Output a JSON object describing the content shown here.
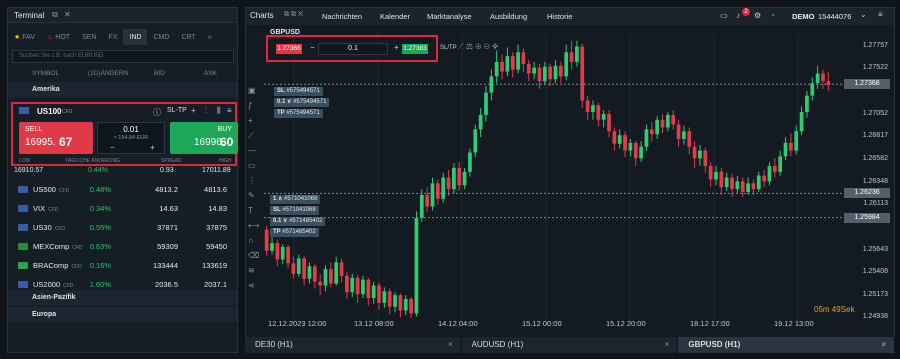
{
  "terminal": {
    "title": "Terminal",
    "tabs": [
      {
        "icon": "star-icon",
        "label": "FAV"
      },
      {
        "icon": "flame-icon",
        "label": "HOT"
      },
      {
        "label": "SEN"
      },
      {
        "label": "FX"
      },
      {
        "label": "IND"
      },
      {
        "label": "CMD"
      },
      {
        "label": "CRT"
      }
    ],
    "more": "»",
    "search_placeholder": "Suchen Sie z.B. nach EURUSD",
    "columns": {
      "symbol": "SYMBOL",
      "change": "(1D)ÄNDERN",
      "bid": "BID",
      "ask": "ASK"
    },
    "groups": {
      "amerika": "Amerika",
      "asien": "Asien-Pazifik",
      "europa": "Europa"
    },
    "selected": {
      "name": "US100",
      "tag": "CFD",
      "info": "ⓘ",
      "sltp": "SL-TP",
      "plus": "+",
      "sell_label": "SELL",
      "sell_big": "16995.",
      "sell_small": "67",
      "buy_label": "BUY",
      "buy_big": "16996.",
      "buy_small": "60",
      "volume": "0.01",
      "margin": "≈ 154.84 EUR",
      "minus": "−",
      "plus2": "+",
      "low": "LOW",
      "daily": "TÄGLICHE ÄNDERUNG",
      "spread": "SPREAD",
      "high": "HIGH",
      "low_v": "16910.57",
      "daily_v": "0.44%",
      "spread_v": "0.93",
      "high_v": "17011.89"
    },
    "rows": [
      {
        "name": "US500",
        "tag": "CFD",
        "chg": "0.48%",
        "bid": "4813.2",
        "ask": "4813.6",
        "flag": "#3c5ba8"
      },
      {
        "name": "VIX",
        "tag": "CFD",
        "chg": "0.34%",
        "bid": "14.63",
        "ask": "14.83",
        "flag": "#3c5ba8"
      },
      {
        "name": "US30",
        "tag": "CFD",
        "chg": "0.55%",
        "bid": "37871",
        "ask": "37875",
        "flag": "#3c5ba8"
      },
      {
        "name": "MEXComp",
        "tag": "CFD",
        "chg": "0.63%",
        "bid": "59309",
        "ask": "59450",
        "flag": "#2a8a3e"
      },
      {
        "name": "BRAComp",
        "tag": "CFD",
        "chg": "0.16%",
        "bid": "133444",
        "ask": "133619",
        "flag": "#2ba34b"
      },
      {
        "name": "US2000",
        "tag": "CFD",
        "chg": "1.60%",
        "bid": "2036.5",
        "ask": "2037.1",
        "flag": "#3c5ba8"
      }
    ]
  },
  "charts": {
    "title": "Charts",
    "nav": [
      "Nachrichten",
      "Kalender",
      "Marktanalyse",
      "Ausbildung",
      "Historie"
    ],
    "demo_label": "DEMO",
    "account": "15444076",
    "badge": "2",
    "order": {
      "symbol": "GBPUSD",
      "sell_price": "1.27368",
      "volume": "0.1",
      "buy_price": "1.27383",
      "sltp": "SL/TP"
    },
    "y_labels": [
      "1.27757",
      "1.27522",
      "1.27368",
      "1.27052",
      "1.26817",
      "1.26582",
      "1.26348",
      "1.26236",
      "1.26113",
      "1.25984",
      "1.25643",
      "1.25408",
      "1.25173",
      "1.24938"
    ],
    "x_labels": [
      "12.12.2023 12:00",
      "13.12 08:00",
      "14.12 04:00",
      "15.12 00:00",
      "15.12 20:00",
      "18.12 17:00",
      "19.12 13:00"
    ],
    "timer": "05m 49Sek",
    "orders_top": [
      {
        "k": "SL",
        "v": "#575494571"
      },
      {
        "k": "0.1 ∨",
        "v": "#575494571"
      },
      {
        "k": "TP",
        "v": "#575494571"
      }
    ],
    "orders_bot": [
      {
        "k": "1 ∧",
        "v": "#571041068"
      },
      {
        "k": "SL",
        "v": "#571041068"
      },
      {
        "k": "0.1 ∨",
        "v": "#571485402"
      },
      {
        "k": "TP",
        "v": "#571485402"
      }
    ]
  },
  "bottom_tabs": [
    {
      "label": "DE30 (H1)",
      "close": "×"
    },
    {
      "label": "AUDUSD (H1)",
      "close": "×"
    },
    {
      "label": "GBPUSD (H1)",
      "close": "×"
    }
  ],
  "colors": {
    "up": "#2ecc71",
    "down": "#e23b4a",
    "bg": "#131a21"
  },
  "candles": [
    [
      1.2586,
      1.2564,
      1.259,
      1.2558
    ],
    [
      1.2564,
      1.2572,
      1.2578,
      1.256
    ],
    [
      1.2572,
      1.2555,
      1.2575,
      1.2548
    ],
    [
      1.2555,
      1.2568,
      1.2571,
      1.255
    ],
    [
      1.2568,
      1.2551,
      1.257,
      1.2546
    ],
    [
      1.2551,
      1.254,
      1.2558,
      1.2535
    ],
    [
      1.254,
      1.2556,
      1.256,
      1.2537
    ],
    [
      1.2556,
      1.2535,
      1.2559,
      1.2528
    ],
    [
      1.2535,
      1.2548,
      1.2552,
      1.253
    ],
    [
      1.2548,
      1.2532,
      1.255,
      1.2525
    ],
    [
      1.2532,
      1.2528,
      1.254,
      1.2518
    ],
    [
      1.2528,
      1.2545,
      1.2549,
      1.2522
    ],
    [
      1.2545,
      1.253,
      1.2552,
      1.2526
    ],
    [
      1.253,
      1.2552,
      1.2558,
      1.2528
    ],
    [
      1.2552,
      1.2538,
      1.2556,
      1.2531
    ],
    [
      1.2538,
      1.2521,
      1.2542,
      1.2514
    ],
    [
      1.2521,
      1.2536,
      1.254,
      1.2516
    ],
    [
      1.2536,
      1.2519,
      1.2539,
      1.251
    ],
    [
      1.2519,
      1.2534,
      1.2538,
      1.2515
    ],
    [
      1.2534,
      1.2515,
      1.2536,
      1.2507
    ],
    [
      1.2515,
      1.2528,
      1.2532,
      1.2509
    ],
    [
      1.2528,
      1.251,
      1.2531,
      1.2503
    ],
    [
      1.251,
      1.2522,
      1.2526,
      1.2505
    ],
    [
      1.2522,
      1.2506,
      1.2525,
      1.2498
    ],
    [
      1.2506,
      1.2518,
      1.2521,
      1.25
    ],
    [
      1.2518,
      1.2502,
      1.252,
      1.2495
    ],
    [
      1.2502,
      1.2514,
      1.2518,
      1.2497
    ],
    [
      1.2514,
      1.2499,
      1.2516,
      1.2494
    ],
    [
      1.2499,
      1.2598,
      1.2605,
      1.2496
    ],
    [
      1.2598,
      1.2622,
      1.2628,
      1.2594
    ],
    [
      1.2622,
      1.261,
      1.263,
      1.2604
    ],
    [
      1.261,
      1.2634,
      1.264,
      1.2606
    ],
    [
      1.2634,
      1.2618,
      1.2638,
      1.2612
    ],
    [
      1.2618,
      1.264,
      1.2645,
      1.2614
    ],
    [
      1.264,
      1.2628,
      1.2648,
      1.2621
    ],
    [
      1.2628,
      1.265,
      1.2655,
      1.2624
    ],
    [
      1.265,
      1.2632,
      1.2656,
      1.2626
    ],
    [
      1.2632,
      1.2646,
      1.265,
      1.2628
    ],
    [
      1.2646,
      1.2666,
      1.267,
      1.2641
    ],
    [
      1.2666,
      1.269,
      1.2695,
      1.2661
    ],
    [
      1.269,
      1.2705,
      1.2712,
      1.2682
    ],
    [
      1.2705,
      1.2728,
      1.2735,
      1.2698
    ],
    [
      1.2728,
      1.2745,
      1.2752,
      1.272
    ],
    [
      1.2745,
      1.276,
      1.2772,
      1.2738
    ],
    [
      1.276,
      1.275,
      1.2768,
      1.2742
    ],
    [
      1.275,
      1.2766,
      1.2775,
      1.2745
    ],
    [
      1.2766,
      1.2752,
      1.277,
      1.2744
    ],
    [
      1.2752,
      1.277,
      1.2778,
      1.2748
    ],
    [
      1.277,
      1.2758,
      1.2774,
      1.275
    ],
    [
      1.2758,
      1.2748,
      1.2762,
      1.274
    ],
    [
      1.2748,
      1.2754,
      1.276,
      1.2742
    ],
    [
      1.2754,
      1.274,
      1.2758,
      1.2732
    ],
    [
      1.274,
      1.2755,
      1.276,
      1.2736
    ],
    [
      1.2755,
      1.2742,
      1.2758,
      1.2735
    ],
    [
      1.2742,
      1.2756,
      1.2762,
      1.2738
    ],
    [
      1.2756,
      1.2745,
      1.276,
      1.2738
    ],
    [
      1.2745,
      1.277,
      1.2778,
      1.2741
    ],
    [
      1.277,
      1.276,
      1.2782,
      1.2752
    ],
    [
      1.276,
      1.2776,
      1.2782,
      1.2755
    ],
    [
      1.2776,
      1.272,
      1.2779,
      1.2712
    ],
    [
      1.272,
      1.2708,
      1.2725,
      1.27
    ],
    [
      1.2708,
      1.2715,
      1.272,
      1.27
    ],
    [
      1.2715,
      1.27,
      1.2718,
      1.2693
    ],
    [
      1.27,
      1.2706,
      1.271,
      1.2692
    ],
    [
      1.2706,
      1.2688,
      1.271,
      1.2682
    ],
    [
      1.2688,
      1.2675,
      1.2692,
      1.2668
    ],
    [
      1.2675,
      1.2684,
      1.269,
      1.267
    ],
    [
      1.2684,
      1.2668,
      1.2688,
      1.2661
    ],
    [
      1.2668,
      1.2676,
      1.268,
      1.2662
    ],
    [
      1.2676,
      1.266,
      1.2678,
      1.2652
    ],
    [
      1.266,
      1.2672,
      1.2678,
      1.2656
    ],
    [
      1.2672,
      1.269,
      1.2695,
      1.2668
    ],
    [
      1.269,
      1.2685,
      1.2698,
      1.2677
    ],
    [
      1.2685,
      1.27,
      1.2704,
      1.268
    ],
    [
      1.27,
      1.2692,
      1.2706,
      1.2686
    ],
    [
      1.2692,
      1.2705,
      1.2708,
      1.2688
    ],
    [
      1.2705,
      1.2695,
      1.271,
      1.269
    ],
    [
      1.2695,
      1.268,
      1.27,
      1.2672
    ],
    [
      1.268,
      1.2688,
      1.2694,
      1.2674
    ],
    [
      1.2688,
      1.2672,
      1.2692,
      1.2664
    ],
    [
      1.2672,
      1.266,
      1.2678,
      1.265
    ],
    [
      1.266,
      1.2668,
      1.2674,
      1.2652
    ],
    [
      1.2668,
      1.2652,
      1.2671,
      1.2645
    ],
    [
      1.2652,
      1.2638,
      1.2656,
      1.263
    ],
    [
      1.2638,
      1.2646,
      1.2652,
      1.2632
    ],
    [
      1.2646,
      1.263,
      1.265,
      1.2622
    ],
    [
      1.263,
      1.264,
      1.2645,
      1.2626
    ],
    [
      1.264,
      1.2628,
      1.2644,
      1.262
    ],
    [
      1.2628,
      1.2636,
      1.2642,
      1.2624
    ],
    [
      1.2636,
      1.2625,
      1.264,
      1.262
    ],
    [
      1.2625,
      1.2634,
      1.264,
      1.2622
    ],
    [
      1.2634,
      1.2628,
      1.2638,
      1.2622
    ],
    [
      1.2628,
      1.2642,
      1.2646,
      1.2625
    ],
    [
      1.2642,
      1.2636,
      1.2648,
      1.263
    ],
    [
      1.2636,
      1.2652,
      1.2656,
      1.2632
    ],
    [
      1.2652,
      1.2646,
      1.266,
      1.264
    ],
    [
      1.2646,
      1.2662,
      1.2668,
      1.2642
    ],
    [
      1.2662,
      1.2676,
      1.2682,
      1.2658
    ],
    [
      1.2676,
      1.2668,
      1.2686,
      1.2662
    ],
    [
      1.2668,
      1.2688,
      1.2694,
      1.2664
    ],
    [
      1.2688,
      1.2708,
      1.2714,
      1.2684
    ],
    [
      1.2708,
      1.2725,
      1.273,
      1.2702
    ],
    [
      1.2725,
      1.2738,
      1.2744,
      1.272
    ],
    [
      1.2738,
      1.2748,
      1.2756,
      1.2732
    ],
    [
      1.2748,
      1.274,
      1.2752,
      1.2732
    ],
    [
      1.274,
      1.2736,
      1.275,
      1.273
    ]
  ]
}
